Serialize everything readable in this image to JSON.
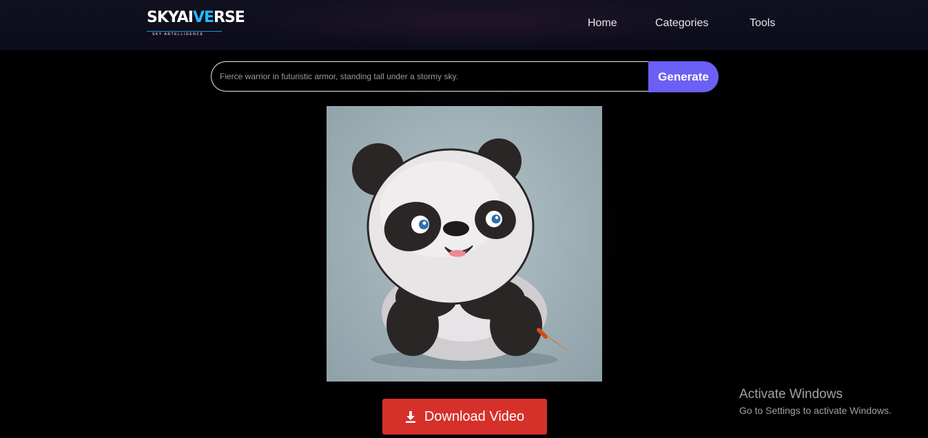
{
  "brand": {
    "logo_prefix": "SKYAI",
    "logo_accent": "VE",
    "logo_suffix": "RSE",
    "tagline": "SKY ARTELLIGENCE",
    "accent_color": "#29b6f6"
  },
  "nav": {
    "items": [
      {
        "label": "Home"
      },
      {
        "label": "Categories"
      },
      {
        "label": "Tools"
      }
    ]
  },
  "prompt": {
    "placeholder": "Fierce warrior in futuristic armor, standing tall under a stormy sky.",
    "value": ""
  },
  "generate_button": {
    "label": "Generate",
    "color": "#6c5ff5"
  },
  "result": {
    "image_subject": "cartoon panda illustration",
    "icon": "panda-illustration"
  },
  "download_button": {
    "label": "Download Video",
    "icon": "download-icon",
    "color": "#d6302a"
  },
  "windows_watermark": {
    "title": "Activate Windows",
    "subtitle": "Go to Settings to activate Windows."
  }
}
